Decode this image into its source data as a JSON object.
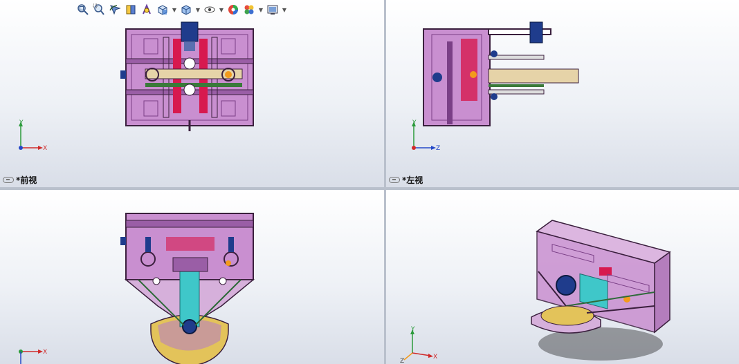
{
  "toolbar": {
    "buttons": [
      {
        "name": "zoom-to-fit-icon",
        "dropdown": false
      },
      {
        "name": "zoom-to-area-icon",
        "dropdown": false
      },
      {
        "name": "previous-view-icon",
        "dropdown": false
      },
      {
        "name": "section-view-icon",
        "dropdown": false
      },
      {
        "name": "dynamic-annotation-icon",
        "dropdown": false
      },
      {
        "name": "view-orientation-icon",
        "dropdown": true
      },
      {
        "name": "display-style-icon",
        "dropdown": true
      },
      {
        "name": "hide-show-items-icon",
        "dropdown": true
      },
      {
        "name": "edit-appearance-icon",
        "dropdown": false
      },
      {
        "name": "apply-scene-icon",
        "dropdown": true
      },
      {
        "name": "view-settings-icon",
        "dropdown": true
      }
    ]
  },
  "viewports": {
    "front": {
      "label": "*前视"
    },
    "left": {
      "label": "*左视"
    },
    "bottom": {
      "label": ""
    },
    "iso": {
      "label": ""
    }
  },
  "triad": {
    "x": "X",
    "y": "Y",
    "z": "Z"
  },
  "colors": {
    "housing": "#c98fd0",
    "housing_edge": "#3a1f3d",
    "accent_red": "#d7194f",
    "accent_cyan": "#3fc7c9",
    "accent_orange": "#f39a1c",
    "tray_yellow": "#e3c35a",
    "motor_blue": "#1f3c8c"
  }
}
